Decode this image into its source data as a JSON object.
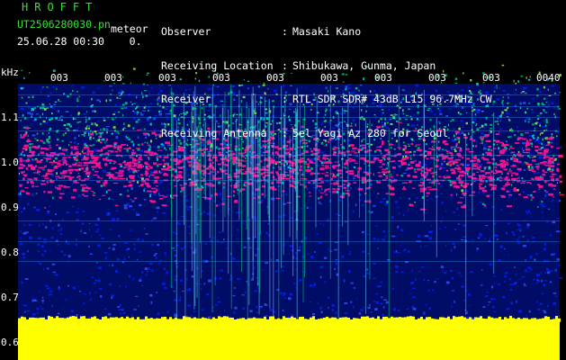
{
  "header": {
    "brand": "HROFFT",
    "filename": "UT2506280030.pn",
    "type": "meteor",
    "timestamp": "25.06.28 00:30",
    "count": "0.",
    "meta": [
      {
        "key": "Observer",
        "sep": ":",
        "value": "Masaki Kano"
      },
      {
        "key": "Receiving Location",
        "sep": ":",
        "value": "Shibukawa, Gunma, Japan"
      },
      {
        "key": "Receiver",
        "sep": ":",
        "value": "RTL-SDR SDR# 43dB L15 96.7MHz CW"
      },
      {
        "key": "Receiving Antenna",
        "sep": ":",
        "value": "5el Yagi Az 280 for Seoul"
      }
    ]
  },
  "axis": {
    "unit": "kHz",
    "time_ticks": [
      "003",
      "003",
      "003",
      "003",
      "003",
      "003",
      "003",
      "003",
      "003",
      "0040"
    ],
    "freq_ticks": [
      "1.1",
      "1.0",
      "0.9",
      "0.8",
      "0.7",
      "0.6"
    ]
  },
  "colors": {
    "background": "#000000",
    "text": "#ffffff",
    "brand": "#38e038",
    "noise_floor": "#ffff00",
    "strong_signal": "#ff1493",
    "blue": "#0022ff",
    "green": "#00cc77"
  }
}
